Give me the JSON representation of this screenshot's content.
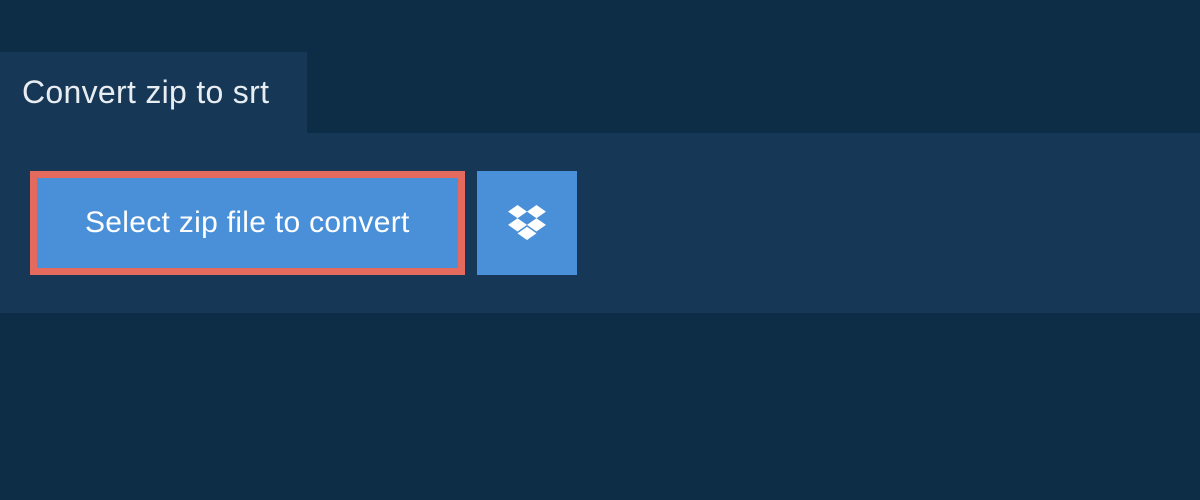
{
  "tab": {
    "title": "Convert zip to srt"
  },
  "actions": {
    "select_file_label": "Select zip file to convert"
  },
  "colors": {
    "background": "#0d2c46",
    "panel": "#163755",
    "button": "#4a90d9",
    "highlight_border": "#e36a5c"
  }
}
